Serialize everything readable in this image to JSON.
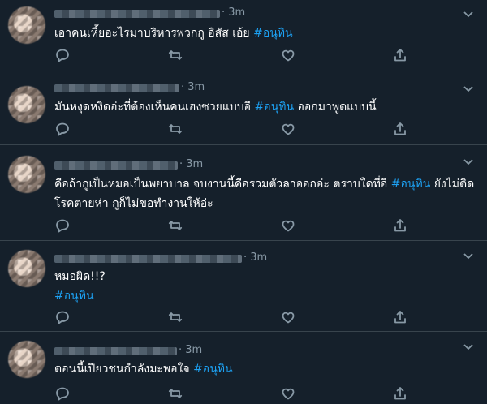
{
  "colors": {
    "background": "#15202b",
    "text": "#ffffff",
    "muted": "#8899a6",
    "hashtag": "#1da1f2",
    "divider": "#38444d"
  },
  "icons": {
    "reply": "reply-icon",
    "retweet": "retweet-icon",
    "like": "like-icon",
    "share": "share-icon",
    "more": "chevron-down-icon"
  },
  "tweets": [
    {
      "time": "· 3m",
      "text": "เอาคนเหี้ยอะไรมาบริหารพวกกู  อิสัส เอ้ย ",
      "hashtag": "#อนุทิน",
      "after": ""
    },
    {
      "time": "· 3m",
      "text": "มันหงุดหงิดอ่ะที่ต้องเห็นคนเฮงซวยแบบอี ",
      "hashtag": "#อนุทิน",
      "after": " ออกมาพูดแบบนี้"
    },
    {
      "time": "· 3m",
      "text": "คือถ้ากูเป็นหมอเป็นพยาบาล จบงานนี้คือรวมตัวลาออกอ่ะ ตราบใดที่อี ",
      "hashtag": "#อนุทิน",
      "after": " ยังไม่ติดโรคตายห่า กูก็ไม่ขอทำงานให้อ่ะ"
    },
    {
      "time": "· 3m",
      "text": "หมอผิด!!?",
      "hashtag": "#อนุทิน",
      "after": ""
    },
    {
      "time": "· 3m",
      "text": "ตอนนี้เปียวชนกำลังมะพอใจ ",
      "hashtag": "#อนุทิน",
      "after": ""
    }
  ]
}
